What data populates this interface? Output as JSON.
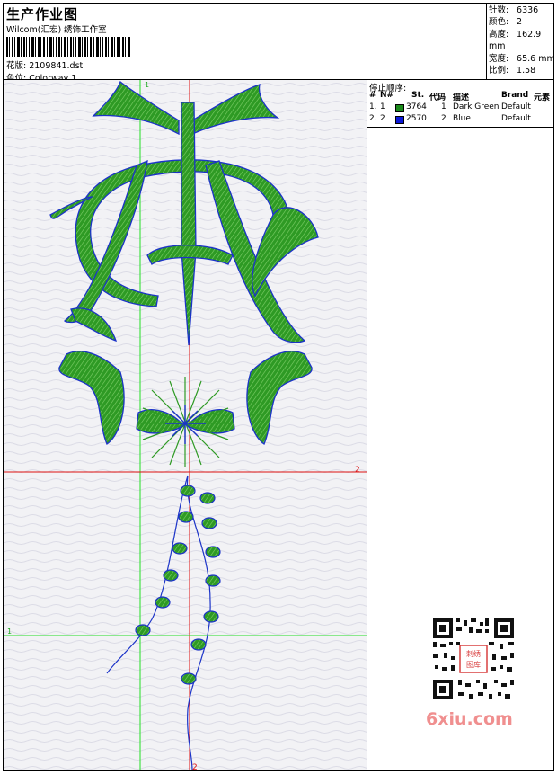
{
  "header": {
    "title": "生产作业图",
    "subtitle": "Wilcom(汇宏) 绣饰工作室",
    "file": "花版: 2109841.dst",
    "colorway": "色位: Colorway 1"
  },
  "stats": [
    {
      "label": "针数:",
      "value": "6336"
    },
    {
      "label": "颜色:",
      "value": "2"
    },
    {
      "label": "高度:",
      "value": "162.9 mm"
    },
    {
      "label": "宽度:",
      "value": "65.6 mm"
    },
    {
      "label": "比例:",
      "value": "1.58"
    }
  ],
  "stop_sequence": {
    "title": "停止顺序:",
    "headers": [
      "#",
      "N#",
      "St.",
      "代码",
      "描述",
      "Brand",
      "元素"
    ],
    "rows": [
      {
        "idx": "1.",
        "n": "1",
        "color": "#1a8a1a",
        "stitches": "3764",
        "code": "1",
        "desc": "Dark Green",
        "brand": "Default",
        "element": ""
      },
      {
        "idx": "2.",
        "n": "2",
        "color": "#0b18d6",
        "stitches": "2570",
        "code": "2",
        "desc": "Blue",
        "brand": "Default",
        "element": ""
      }
    ]
  },
  "guides": {
    "v_label_top": "1",
    "h_label_right": "2",
    "h_label_left": "1",
    "v_label_bottom": "2"
  },
  "qr_badge": "刺绣图库",
  "watermark": "6xiu.com"
}
